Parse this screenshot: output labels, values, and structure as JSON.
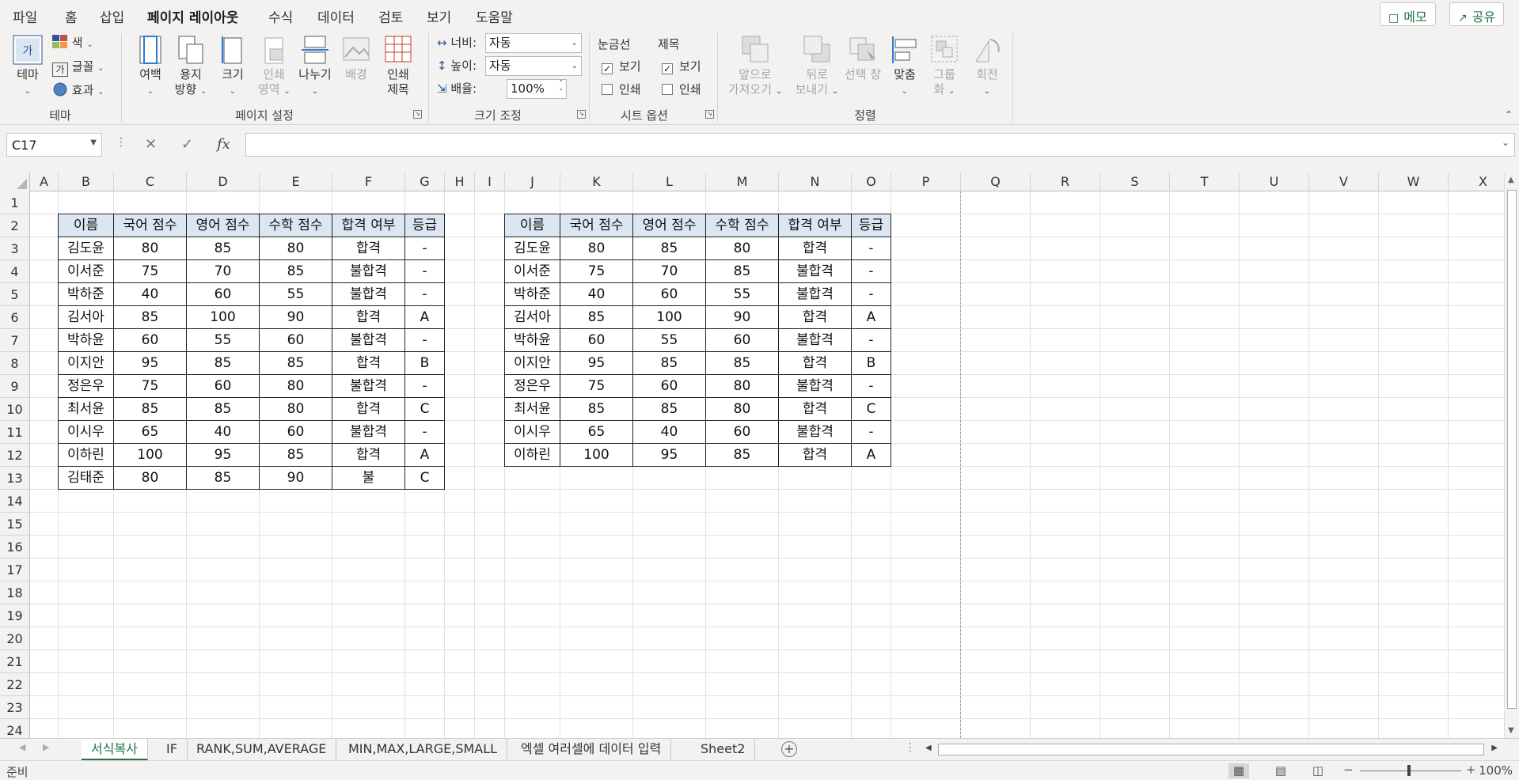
{
  "menu": {
    "items": [
      "파일",
      "홈",
      "삽입",
      "페이지 레이아웃",
      "수식",
      "데이터",
      "검토",
      "보기",
      "도움말"
    ],
    "active_index": 3,
    "memo_label": "메모",
    "share_label": "공유"
  },
  "ribbon": {
    "theme": {
      "big_label": "테마",
      "colors": "색",
      "fonts": "글꼴",
      "effects": "효과",
      "group": "테마"
    },
    "page_setup": {
      "margins": "여백",
      "orientation": [
        "용지",
        "방향"
      ],
      "size": "크기",
      "print_area": [
        "인쇄",
        "영역"
      ],
      "breaks": "나누기",
      "background": "배경",
      "print_titles": [
        "인쇄",
        "제목"
      ],
      "group": "페이지 설정"
    },
    "scale": {
      "width_label": "너비:",
      "width_value": "자동",
      "height_label": "높이:",
      "height_value": "자동",
      "scale_label": "배율:",
      "scale_value": "100%",
      "group": "크기 조정"
    },
    "sheet_options": {
      "gridlines": "눈금선",
      "headings": "제목",
      "view": "보기",
      "print": "인쇄",
      "gridlines_view": true,
      "gridlines_print": false,
      "headings_view": true,
      "headings_print": false,
      "group": "시트 옵션"
    },
    "arrange": {
      "bring_forward": [
        "앞으로",
        "가져오기"
      ],
      "send_backward": [
        "뒤로",
        "보내기"
      ],
      "selection_pane": "선택 창",
      "align": "맞춤",
      "group_btn": [
        "그룹",
        "화"
      ],
      "rotate": "회전",
      "group": "정렬"
    }
  },
  "formula_bar": {
    "name_box": "C17",
    "formula": "",
    "fx": "fx"
  },
  "columns": [
    "A",
    "B",
    "C",
    "D",
    "E",
    "F",
    "G",
    "H",
    "I",
    "J",
    "K",
    "L",
    "M",
    "N",
    "O",
    "P",
    "Q",
    "R",
    "S",
    "T",
    "U",
    "V",
    "W",
    "X"
  ],
  "rows": [
    "1",
    "2",
    "3",
    "4",
    "5",
    "6",
    "7",
    "8",
    "9",
    "10",
    "11",
    "12",
    "13",
    "14",
    "15",
    "16",
    "17",
    "18",
    "19",
    "20",
    "21",
    "22",
    "23",
    "24"
  ],
  "table1": {
    "headers": [
      "이름",
      "국어 점수",
      "영어 점수",
      "수학 점수",
      "합격 여부",
      "등급"
    ],
    "rows": [
      [
        "김도윤",
        "80",
        "85",
        "80",
        "합격",
        "-"
      ],
      [
        "이서준",
        "75",
        "70",
        "85",
        "불합격",
        "-"
      ],
      [
        "박하준",
        "40",
        "60",
        "55",
        "불합격",
        "-"
      ],
      [
        "김서아",
        "85",
        "100",
        "90",
        "합격",
        "A"
      ],
      [
        "박하윤",
        "60",
        "55",
        "60",
        "불합격",
        "-"
      ],
      [
        "이지안",
        "95",
        "85",
        "85",
        "합격",
        "B"
      ],
      [
        "정은우",
        "75",
        "60",
        "80",
        "불합격",
        "-"
      ],
      [
        "최서윤",
        "85",
        "85",
        "80",
        "합격",
        "C"
      ],
      [
        "이시우",
        "65",
        "40",
        "60",
        "불합격",
        "-"
      ],
      [
        "이하린",
        "100",
        "95",
        "85",
        "합격",
        "A"
      ],
      [
        "김태준",
        "80",
        "85",
        "90",
        "불",
        "C"
      ]
    ]
  },
  "table2": {
    "headers": [
      "이름",
      "국어 점수",
      "영어 점수",
      "수학 점수",
      "합격 여부",
      "등급"
    ],
    "rows": [
      [
        "김도윤",
        "80",
        "85",
        "80",
        "합격",
        "-"
      ],
      [
        "이서준",
        "75",
        "70",
        "85",
        "불합격",
        "-"
      ],
      [
        "박하준",
        "40",
        "60",
        "55",
        "불합격",
        "-"
      ],
      [
        "김서아",
        "85",
        "100",
        "90",
        "합격",
        "A"
      ],
      [
        "박하윤",
        "60",
        "55",
        "60",
        "불합격",
        "-"
      ],
      [
        "이지안",
        "95",
        "85",
        "85",
        "합격",
        "B"
      ],
      [
        "정은우",
        "75",
        "60",
        "80",
        "불합격",
        "-"
      ],
      [
        "최서윤",
        "85",
        "85",
        "80",
        "합격",
        "C"
      ],
      [
        "이시우",
        "65",
        "40",
        "60",
        "불합격",
        "-"
      ],
      [
        "이하린",
        "100",
        "95",
        "85",
        "합격",
        "A"
      ]
    ]
  },
  "sheet_tabs": [
    "서식복사",
    "IF",
    "RANK,SUM,AVERAGE",
    "MIN,MAX,LARGE,SMALL",
    "엑셀 여러셀에 데이터 입력",
    "Sheet2"
  ],
  "active_tab": 0,
  "status": {
    "text": "준비",
    "zoom": "100%"
  },
  "colors": {
    "accent": "#217346",
    "header_fill": "#dce6f3"
  }
}
